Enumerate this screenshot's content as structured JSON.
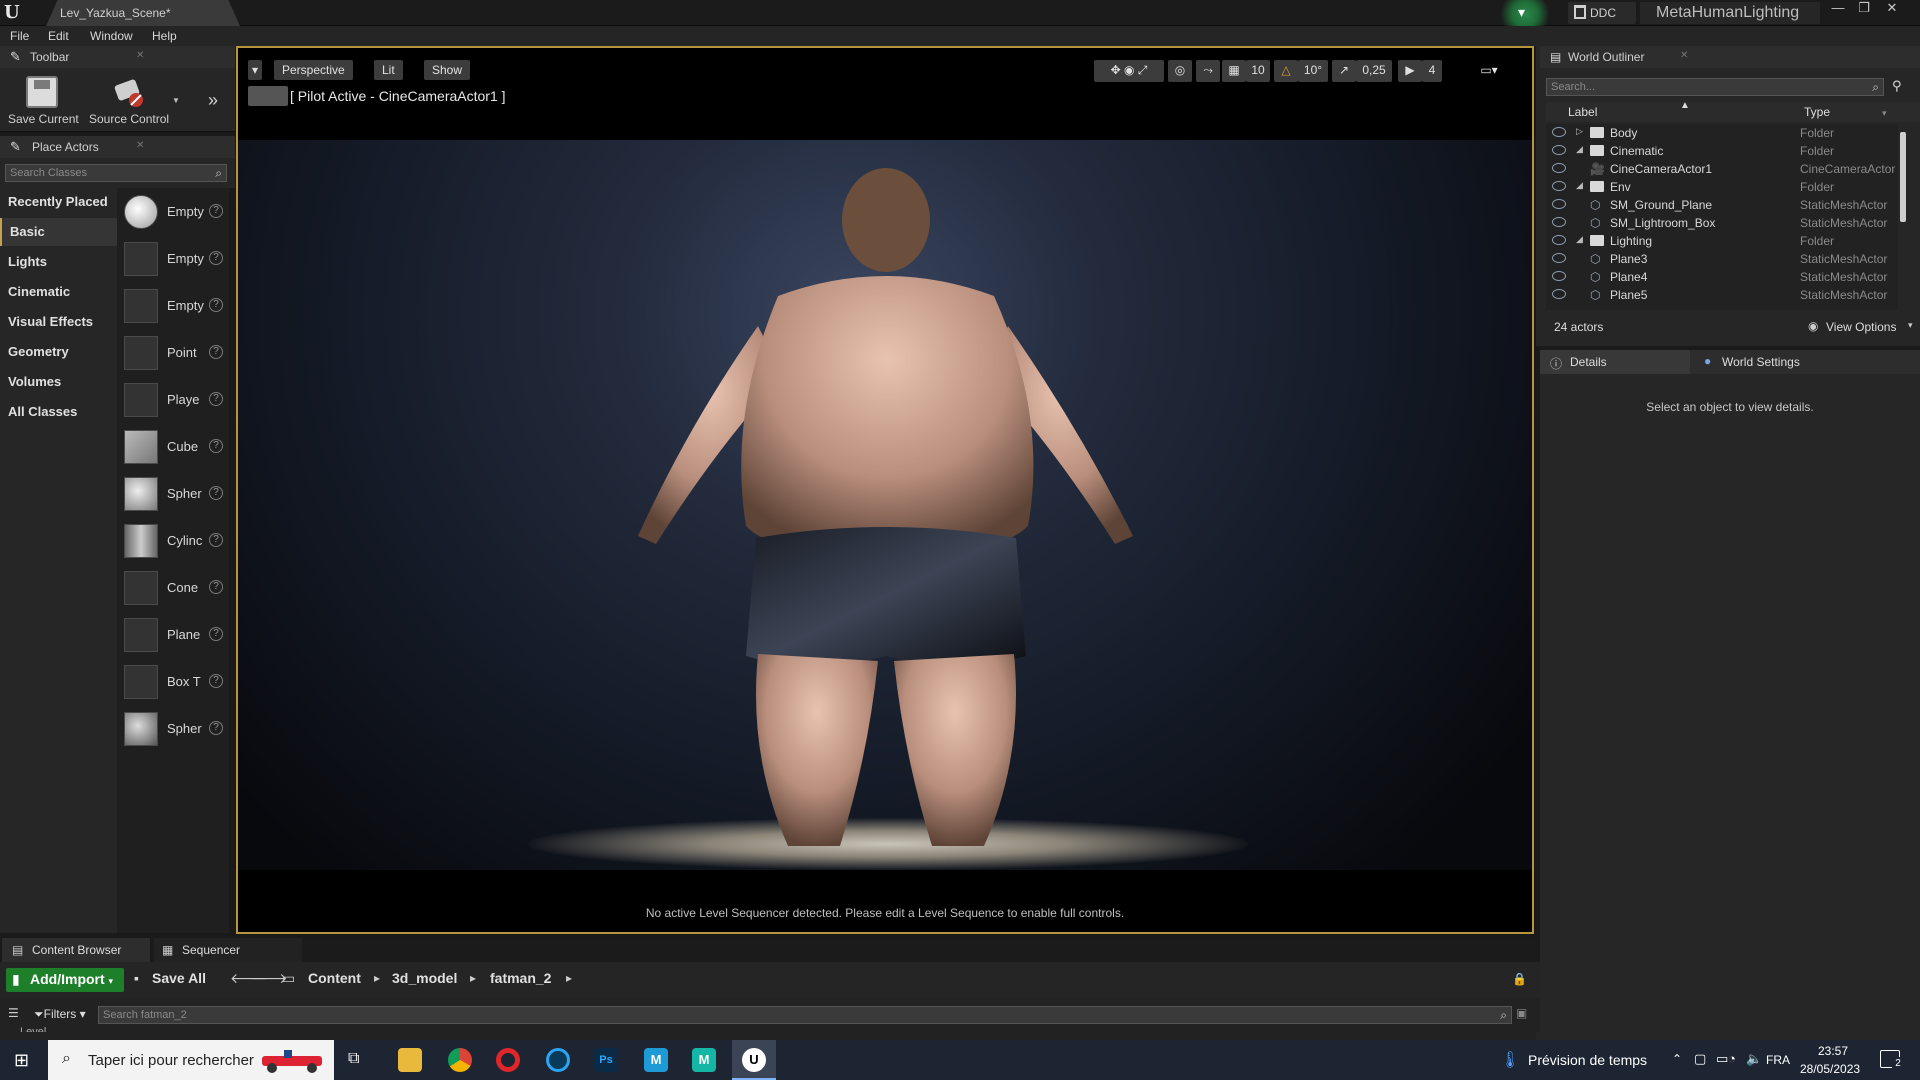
{
  "window": {
    "document_tab": "Lev_Yazkua_Scene*",
    "ddc_label": "DDC",
    "project_name": "MetaHumanLighting"
  },
  "menu": [
    "File",
    "Edit",
    "Window",
    "Help"
  ],
  "toolbar_panel": {
    "title": "Toolbar",
    "save_current": "Save Current",
    "source_control": "Source Control"
  },
  "place_actors": {
    "title": "Place Actors",
    "search_placeholder": "Search Classes",
    "categories": [
      "Recently Placed",
      "Basic",
      "Lights",
      "Cinematic",
      "Visual Effects",
      "Geometry",
      "Volumes",
      "All Classes"
    ],
    "active_category": "Basic",
    "items": [
      "Empty",
      "Empty",
      "Empty",
      "Point",
      "Playe",
      "Cube",
      "Spher",
      "Cylinc",
      "Cone",
      "Plane",
      "Box T",
      "Spher"
    ]
  },
  "viewport": {
    "perspective": "Perspective",
    "lit": "Lit",
    "show": "Show",
    "pilot_label": "[ Pilot Active - CineCameraActor1 ]",
    "grid_snap": "10",
    "rot_snap": "10°",
    "scale_snap": "0,25",
    "cam_speed": "4",
    "sequencer_msg": "No active Level Sequencer detected. Please edit a Level Sequence to enable full controls."
  },
  "world_outliner": {
    "title": "World Outliner",
    "search_placeholder": "Search...",
    "col_label": "Label",
    "col_type": "Type",
    "rows": [
      {
        "label": "Body",
        "type": "Folder",
        "kind": "folder",
        "indent": 0,
        "expanded": false
      },
      {
        "label": "Cinematic",
        "type": "Folder",
        "kind": "folder",
        "indent": 0,
        "expanded": true
      },
      {
        "label": "CineCameraActor1",
        "type": "CineCameraActor",
        "kind": "actor",
        "indent": 1
      },
      {
        "label": "Env",
        "type": "Folder",
        "kind": "folder",
        "indent": 0,
        "expanded": true
      },
      {
        "label": "SM_Ground_Plane",
        "type": "StaticMeshActor",
        "kind": "actor",
        "indent": 1
      },
      {
        "label": "SM_Lightroom_Box",
        "type": "StaticMeshActor",
        "kind": "actor",
        "indent": 1
      },
      {
        "label": "Lighting",
        "type": "Folder",
        "kind": "folder",
        "indent": 0,
        "expanded": true
      },
      {
        "label": "Plane3",
        "type": "StaticMeshActor",
        "kind": "actor",
        "indent": 1
      },
      {
        "label": "Plane4",
        "type": "StaticMeshActor",
        "kind": "actor",
        "indent": 1
      },
      {
        "label": "Plane5",
        "type": "StaticMeshActor",
        "kind": "actor",
        "indent": 1
      }
    ],
    "actor_count": "24 actors",
    "view_options": "View Options"
  },
  "details": {
    "tab_details": "Details",
    "tab_world_settings": "World Settings",
    "empty_msg": "Select an object to view details."
  },
  "content_browser": {
    "tab_content": "Content Browser",
    "tab_sequencer": "Sequencer",
    "add_import": "Add/Import",
    "save_all": "Save All",
    "breadcrumbs": [
      "Content",
      "3d_model",
      "fatman_2"
    ],
    "filters": "Filters",
    "search_placeholder": "Search fatman_2",
    "partial_row": "Level"
  },
  "taskbar": {
    "search_placeholder": "Taper ici pour rechercher",
    "weather": "Prévision de temps",
    "lang": "FRA",
    "time": "23:57",
    "date": "28/05/2023",
    "notification_count": "2"
  },
  "colors": {
    "viewport_border": "#b6953e",
    "add_import_bg": "#1e7f2a",
    "taskbar_bg": "#1d2532"
  }
}
